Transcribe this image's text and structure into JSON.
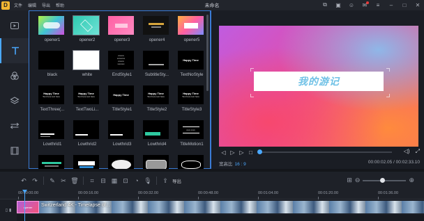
{
  "titlebar": {
    "logo": "D",
    "menu": [
      "文件",
      "编辑",
      "导出",
      "帮助"
    ],
    "title": "未命名",
    "icons": [
      "feedback-icon",
      "chat-icon",
      "user-icon",
      "notification-icon",
      "menu-icon",
      "minimize-icon",
      "maximize-icon",
      "close-icon"
    ]
  },
  "sidebar": {
    "tools": [
      {
        "name": "media",
        "icon": "media-icon"
      },
      {
        "name": "text",
        "icon": "text-icon",
        "active": true
      },
      {
        "name": "filters",
        "icon": "filter-icon"
      },
      {
        "name": "overlays",
        "icon": "overlay-icon"
      },
      {
        "name": "transitions",
        "icon": "transition-icon"
      },
      {
        "name": "elements",
        "icon": "film-icon"
      }
    ]
  },
  "gallery": {
    "items": [
      {
        "label": "opener1",
        "style": "opener1"
      },
      {
        "label": "opener2",
        "style": "opener2"
      },
      {
        "label": "opener3",
        "style": "opener3"
      },
      {
        "label": "opener4",
        "style": "opener4"
      },
      {
        "label": "opener5",
        "style": "opener5"
      },
      {
        "label": "black",
        "style": "black"
      },
      {
        "label": "white",
        "style": "white"
      },
      {
        "label": "EndStyle1",
        "style": "end"
      },
      {
        "label": "SubtitleSty...",
        "style": "subtitle"
      },
      {
        "label": "TextNoStyle",
        "style": "textnostyle"
      },
      {
        "label": "TextThree(...",
        "style": "textthree"
      },
      {
        "label": "TextTwoLi...",
        "style": "texttwo"
      },
      {
        "label": "TitleStyle1",
        "style": "title1"
      },
      {
        "label": "TitleStyle2",
        "style": "title2"
      },
      {
        "label": "TitleStyle3",
        "style": "title3"
      },
      {
        "label": "Lowthrid1",
        "style": "low1"
      },
      {
        "label": "Lowthrid2",
        "style": "low2"
      },
      {
        "label": "Lowthrid3",
        "style": "low3"
      },
      {
        "label": "Lowthrid4",
        "style": "low4"
      },
      {
        "label": "TitleMotion1",
        "style": "motion1"
      },
      {
        "label": "",
        "style": "row5a"
      },
      {
        "label": "",
        "style": "row5b"
      },
      {
        "label": "",
        "style": "row5c"
      },
      {
        "label": "",
        "style": "row5d"
      },
      {
        "label": "",
        "style": "row5e"
      }
    ],
    "thumb_text": {
      "happy_time": "Happy Time",
      "text_here": "Text here text here"
    }
  },
  "preview": {
    "caption": "我的游记",
    "aspect_label": "宽高比",
    "aspect_value": "16 : 9",
    "timecode": "00:00:02.05 / 00:02:33.10",
    "progress_fraction": 0.0
  },
  "timeline": {
    "export_label": "导出",
    "ruler": [
      "00:00:00.00",
      "00:00:16.00",
      "00:00:32.00",
      "00:00:48.00",
      "00:01:04.00",
      "00:01:20.00",
      "00:01:36.00"
    ],
    "clips": [
      {
        "title": "opener",
        "type": "text"
      },
      {
        "title": "Switzerland 4K - Timelapse of...",
        "type": "video"
      }
    ],
    "zoom_fraction": 0.45
  }
}
